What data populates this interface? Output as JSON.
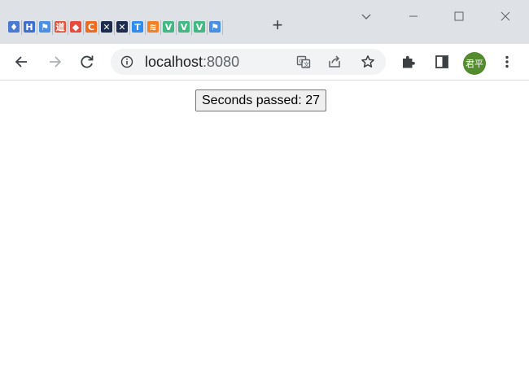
{
  "browser": {
    "tabs": [
      {
        "icon": "blue-puzzle-favicon",
        "glyph": "♦",
        "color": "#4a7bd0"
      },
      {
        "icon": "blue-book-favicon",
        "glyph": "H",
        "color": "#3d6fd1"
      },
      {
        "icon": "blue-flag-favicon",
        "glyph": "⚑",
        "color": "#4a90e2"
      },
      {
        "icon": "red-app-favicon",
        "glyph": "道",
        "color": "#e0533c"
      },
      {
        "icon": "diamond-favicon",
        "glyph": "◆",
        "color": "#e74c3c"
      },
      {
        "icon": "orange-c-favicon",
        "glyph": "C",
        "color": "#f06a1d"
      },
      {
        "icon": "cross-favicon",
        "glyph": "✕",
        "color": "#1d2c4d"
      },
      {
        "icon": "cross-favicon",
        "glyph": "✕",
        "color": "#1d2c4d"
      },
      {
        "icon": "t-favicon",
        "glyph": "T",
        "color": "#2d8cf0"
      },
      {
        "icon": "stack-favicon",
        "glyph": "≋",
        "color": "#f48024"
      },
      {
        "icon": "vue-favicon",
        "glyph": "V",
        "color": "#42b883"
      },
      {
        "icon": "vue-favicon",
        "glyph": "V",
        "color": "#42b883"
      },
      {
        "icon": "vue-favicon",
        "glyph": "V",
        "color": "#42b883"
      },
      {
        "icon": "blue-flag-favicon",
        "glyph": "⚑",
        "color": "#4a90e2"
      }
    ],
    "new_tab_glyph": "+",
    "omnibox": {
      "host": "localhost",
      "port": ":8080"
    },
    "profile_avatar_text": "君平",
    "accent": "#558b2f"
  },
  "page": {
    "counter_button": "Seconds passed: 27"
  }
}
